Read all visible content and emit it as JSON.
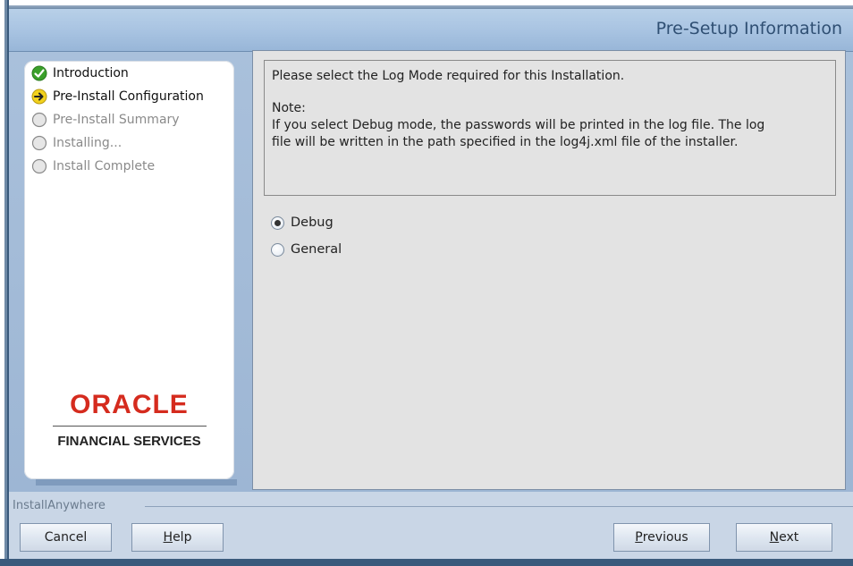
{
  "header": {
    "title": "Pre-Setup Information"
  },
  "steps": [
    {
      "label": "Introduction",
      "state": "completed",
      "icon": "check-circle-icon"
    },
    {
      "label": "Pre-Install Configuration",
      "state": "current",
      "icon": "arrow-circle-icon"
    },
    {
      "label": "Pre-Install Summary",
      "state": "pending",
      "icon": "empty-circle-icon"
    },
    {
      "label": "Installing...",
      "state": "pending",
      "icon": "empty-circle-icon"
    },
    {
      "label": "Install Complete",
      "state": "pending",
      "icon": "empty-circle-icon"
    }
  ],
  "logo": {
    "oracle": "ORACLE",
    "subtitle": "FINANCIAL SERVICES"
  },
  "info": {
    "line1": "Please select the Log Mode required for this Installation.",
    "note_label": "Note:",
    "note_text1": "If you select Debug mode, the passwords will be printed in the log file. The log",
    "note_text2": "file will be written in the path specified in the log4j.xml file of the installer."
  },
  "log_mode": {
    "selected": "Debug",
    "options": [
      "Debug",
      "General"
    ]
  },
  "footer": {
    "brand": "InstallAnywhere",
    "cancel": "Cancel",
    "help_mnemonic": "H",
    "help_rest": "elp",
    "previous_mnemonic": "P",
    "previous_rest": "revious",
    "next_mnemonic": "N",
    "next_rest": "ext"
  },
  "colors": {
    "oracle_red": "#d52b1e",
    "header_text": "#2f4f73",
    "check_green": "#3aa02a",
    "arrow_yellow": "#f2d11c"
  }
}
